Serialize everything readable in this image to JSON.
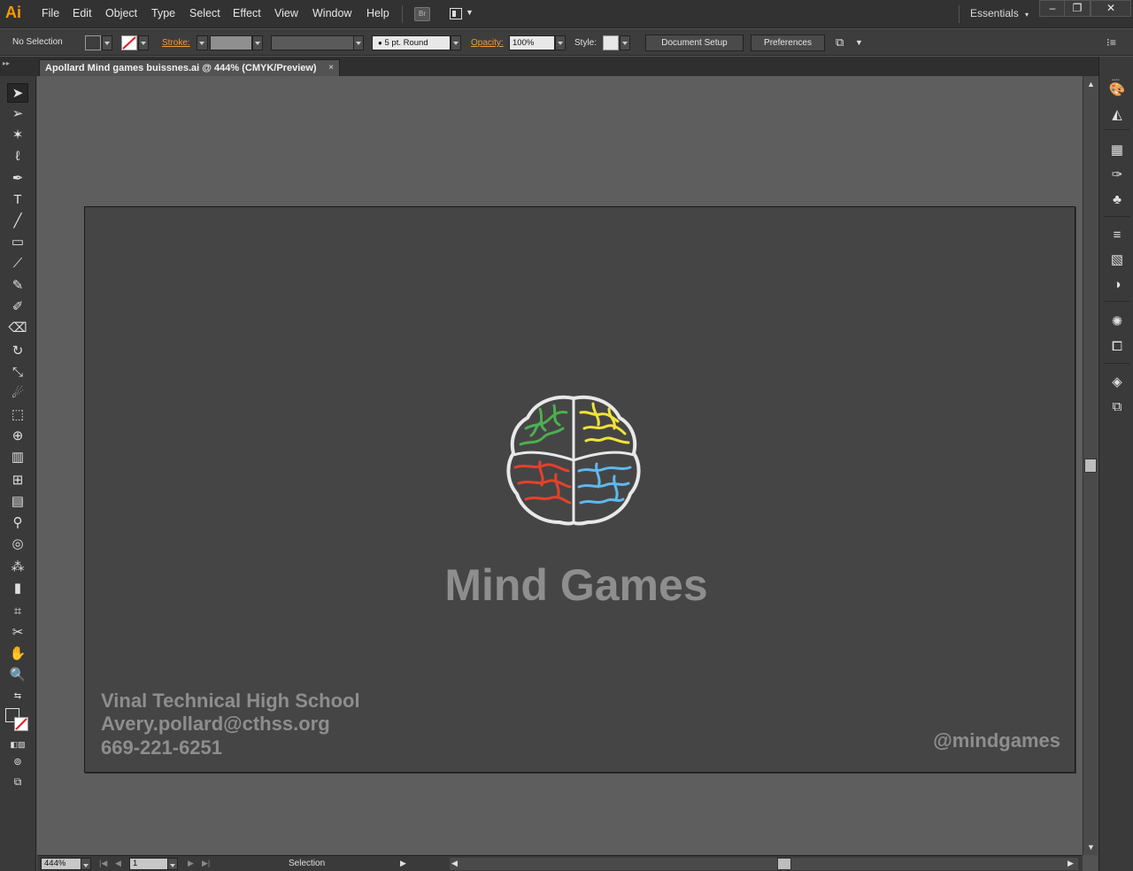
{
  "app": {
    "logo": "Ai",
    "menu": [
      "File",
      "Edit",
      "Object",
      "Type",
      "Select",
      "Effect",
      "View",
      "Window",
      "Help"
    ],
    "bridge_label": "Br",
    "workspace": "Essentials",
    "window_buttons": [
      "–",
      "❐",
      "✕"
    ]
  },
  "control": {
    "selection_status": "No Selection",
    "stroke_label": "Stroke:",
    "brush_label": "5 pt. Round",
    "opacity_label": "Opacity:",
    "opacity_value": "100%",
    "style_label": "Style:",
    "document_setup": "Document Setup",
    "preferences": "Preferences"
  },
  "document": {
    "tab_title": "Apollard Mind games buissnes.ai @ 444% (CMYK/Preview)",
    "close_glyph": "×"
  },
  "artboard": {
    "title": "Mind Games",
    "contact_lines": [
      "Vinal Technical High School",
      "Avery.pollard@cthss.org",
      "669-221-6251"
    ],
    "handle": "@mindgames",
    "brain_colors": [
      "#4caf50",
      "#f2e23a",
      "#e5412b",
      "#5fb8f0"
    ]
  },
  "statusbar": {
    "zoom": "444%",
    "artboard_number": "1",
    "status_text": "Selection"
  },
  "tools": [
    "selection-tool",
    "direct-selection-tool",
    "magic-wand-tool",
    "lasso-tool",
    "pen-tool",
    "type-tool",
    "line-segment-tool",
    "rectangle-tool",
    "paintbrush-tool",
    "pencil-tool",
    "blob-brush-tool",
    "eraser-tool",
    "rotate-tool",
    "scale-tool",
    "warp-tool",
    "free-transform-tool",
    "shape-builder-tool",
    "perspective-grid-tool",
    "mesh-tool",
    "gradient-tool",
    "eyedropper-tool",
    "blend-tool",
    "symbol-sprayer-tool",
    "column-graph-tool",
    "artboard-tool",
    "slice-tool",
    "hand-tool",
    "zoom-tool"
  ],
  "dock_panels": [
    "color-panel",
    "color-guide-panel",
    "swatches-panel",
    "brushes-panel",
    "symbols-panel",
    "stroke-panel",
    "gradient-panel",
    "transparency-panel",
    "appearance-panel",
    "graphic-styles-panel",
    "layers-panel",
    "artboards-panel"
  ]
}
